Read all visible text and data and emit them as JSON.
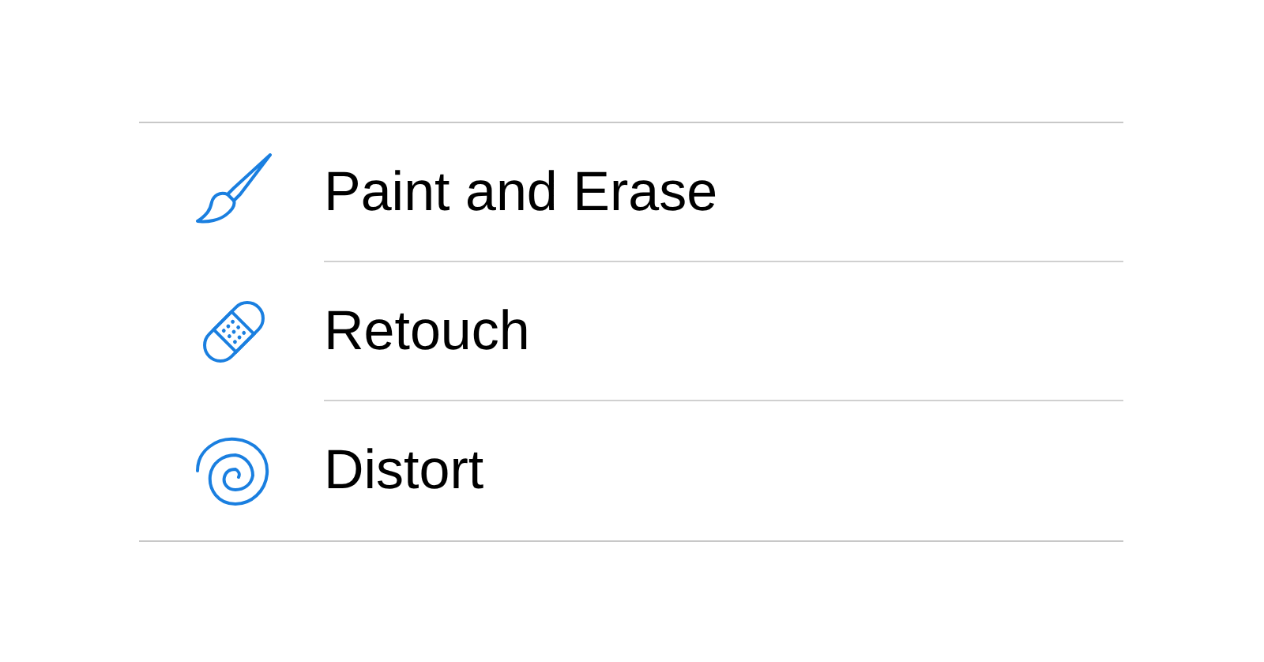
{
  "items": [
    {
      "label": "Paint and Erase",
      "kind": "brush"
    },
    {
      "label": "Retouch",
      "kind": "bandage"
    },
    {
      "label": "Distort",
      "kind": "spiral"
    }
  ]
}
